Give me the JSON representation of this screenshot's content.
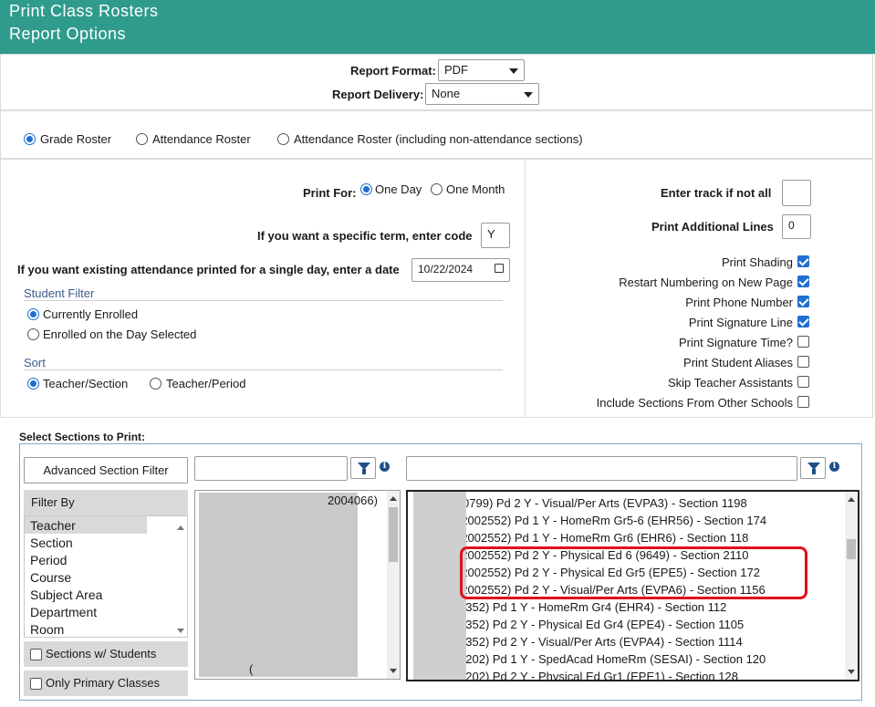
{
  "header": {
    "title": "Print Class Rosters",
    "subtitle": "Report Options"
  },
  "report": {
    "format_label": "Report Format:",
    "format_value": "PDF",
    "delivery_label": "Report Delivery:",
    "delivery_value": "None"
  },
  "roster_types": [
    "Grade Roster",
    "Attendance Roster",
    "Attendance Roster (including non-attendance sections)"
  ],
  "options": {
    "print_for_label": "Print For:",
    "one_day": "One Day",
    "one_month": "One Month",
    "term_label": "If you want a specific term, enter code",
    "term_value": "Y",
    "date_label": "If you want existing attendance printed for a single day, enter a date",
    "date_value": "10/22/2024",
    "student_filter_title": "Student Filter",
    "currently_enrolled": "Currently Enrolled",
    "enrolled_on_day": "Enrolled on the Day Selected",
    "sort_title": "Sort",
    "teacher_section": "Teacher/Section",
    "teacher_period": "Teacher/Period",
    "track_label": "Enter track if not all",
    "track_value": "",
    "additional_lines_label": "Print Additional Lines",
    "additional_lines_value": "0"
  },
  "checkboxes": [
    {
      "label": "Print Shading",
      "checked": true
    },
    {
      "label": "Restart Numbering on New Page",
      "checked": true
    },
    {
      "label": "Print Phone Number",
      "checked": true
    },
    {
      "label": "Print Signature Line",
      "checked": true
    },
    {
      "label": "Print Signature Time?",
      "checked": false
    },
    {
      "label": "Print Student Aliases",
      "checked": false
    },
    {
      "label": "Skip Teacher Assistants",
      "checked": false
    },
    {
      "label": "Include Sections From Other Schools",
      "checked": false
    }
  ],
  "sections": {
    "title": "Select Sections to Print:",
    "advanced_filter_button": "Advanced Section Filter",
    "filter_by_title": "Filter By",
    "filter_by_items": [
      "Teacher",
      "Section",
      "Period",
      "Course",
      "Subject Area",
      "Department",
      "Room"
    ],
    "sections_with_students": "Sections w/ Students",
    "only_primary_classes": "Only Primary Classes",
    "teacher_list_first_visible": "2004066)",
    "teacher_list_last_visible": "(",
    "section_rows": [
      "(2000799) Pd 2 Y - Visual/Per Arts (EVPA3) - Section 1198",
      "(2002552) Pd 1 Y - HomeRm Gr5-6 (EHR56) - Section 174",
      "(2002552) Pd 1 Y - HomeRm Gr6 (EHR6) - Section 118",
      "(2002552) Pd 2 Y - Physical Ed 6 (9649) - Section 2110",
      "(2002552) Pd 2 Y - Physical Ed Gr5 (EPE5) - Section 172",
      "(2002552) Pd 2 Y - Visual/Per Arts (EVPA6) - Section 1156",
      "(2001352) Pd 1 Y - HomeRm Gr4 (EHR4) - Section 112",
      "(2001352) Pd 2 Y - Physical Ed Gr4 (EPE4) - Section 1105",
      "(2001352) Pd 2 Y - Visual/Per Arts (EVPA4) - Section 1114",
      "(2003202) Pd 1 Y - SpedAcad HomeRm (SESAI) - Section 120",
      "(2003202) Pd 2 Y - Physical Ed Gr1 (EPE1) - Section 128"
    ]
  }
}
